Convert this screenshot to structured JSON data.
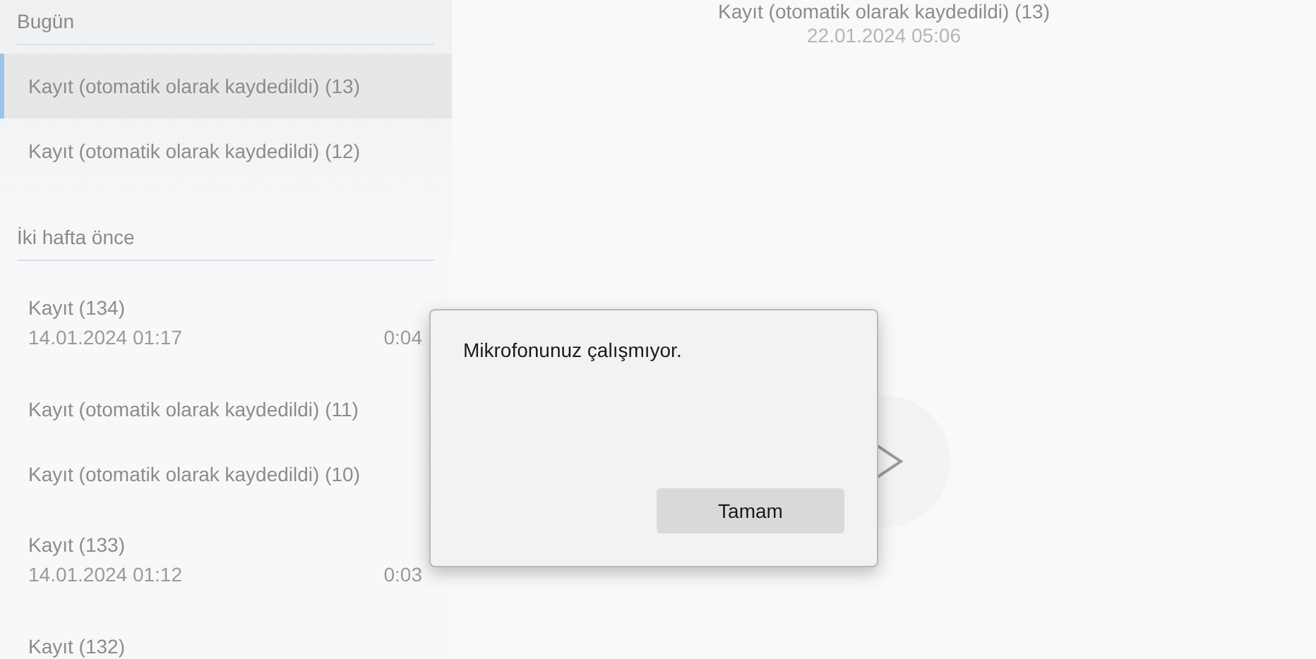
{
  "sidebar": {
    "groups": [
      {
        "header": "Bugün",
        "items": [
          {
            "kind": "single",
            "title": "Kayıt (otomatik olarak kaydedildi) (13)",
            "selected": true
          },
          {
            "kind": "single",
            "title": "Kayıt (otomatik olarak kaydedildi) (12)",
            "selected": false
          }
        ]
      },
      {
        "header": "İki hafta önce",
        "items": [
          {
            "kind": "detailed",
            "title": "Kayıt (134)",
            "date": "14.01.2024 01:17",
            "duration": "0:04",
            "selected": false
          },
          {
            "kind": "single",
            "title": "Kayıt (otomatik olarak kaydedildi) (11)",
            "selected": false
          },
          {
            "kind": "single",
            "title": "Kayıt (otomatik olarak kaydedildi) (10)",
            "selected": false
          },
          {
            "kind": "detailed",
            "title": "Kayıt (133)",
            "date": "14.01.2024 01:12",
            "duration": "0:03",
            "selected": false
          },
          {
            "kind": "single",
            "title": "Kayıt (132)",
            "selected": false
          }
        ]
      }
    ]
  },
  "player": {
    "title": "Kayıt (otomatik olarak kaydedildi) (13)",
    "date": "22.01.2024 05:06"
  },
  "dialog": {
    "message": "Mikrofonunuz çalışmıyor.",
    "button": "Tamam"
  }
}
